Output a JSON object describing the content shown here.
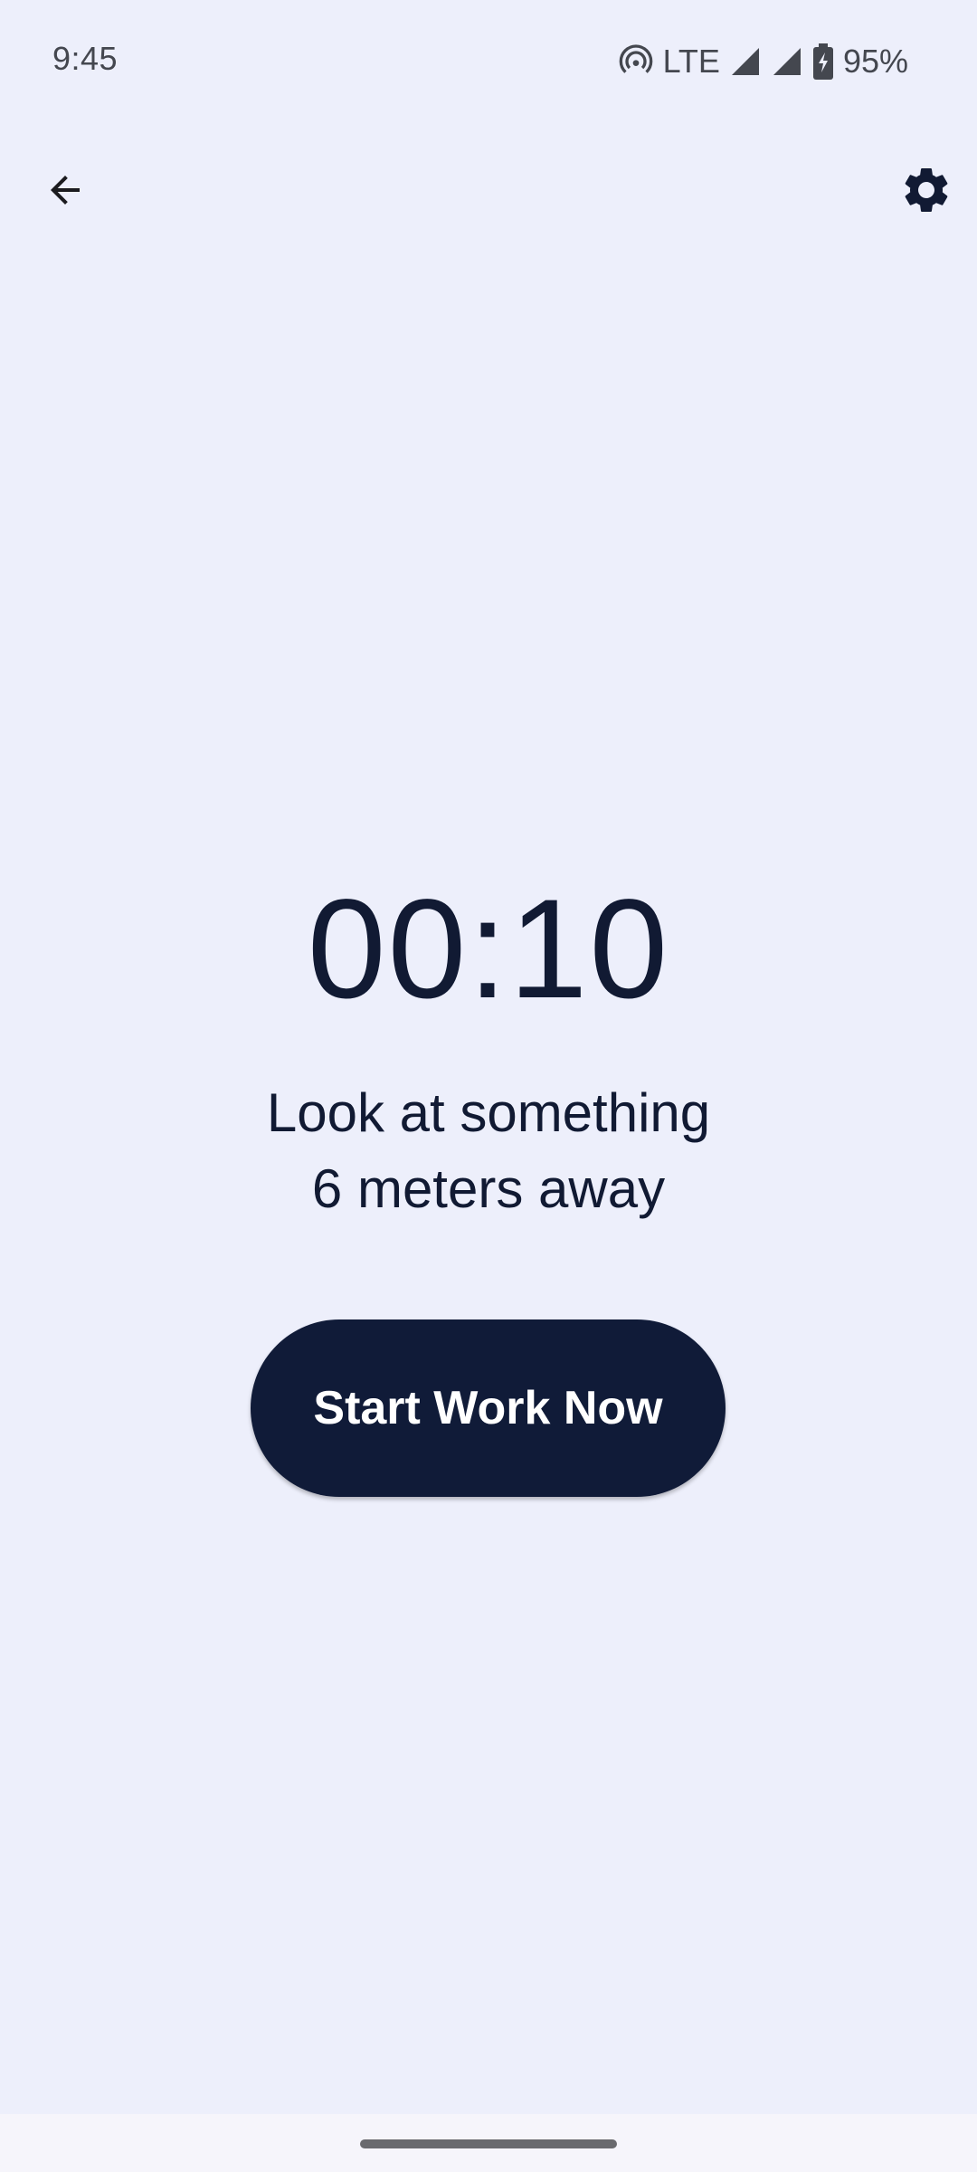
{
  "status_bar": {
    "time": "9:45",
    "network": "LTE",
    "battery": "95%",
    "icons": [
      "hotspot-icon",
      "signal-icon",
      "signal-icon",
      "battery-charging-icon"
    ]
  },
  "app_bar": {
    "back_icon": "arrow-back-icon",
    "settings_icon": "gear-icon"
  },
  "timer": {
    "value": "00:10"
  },
  "instruction": {
    "line1": "Look at something",
    "line2": "6 meters away"
  },
  "actions": {
    "start_label": "Start Work Now"
  },
  "colors": {
    "background": "#EDEFFB",
    "primary": "#101B38",
    "on_primary": "#FFFFFF",
    "text": "#111A33"
  }
}
